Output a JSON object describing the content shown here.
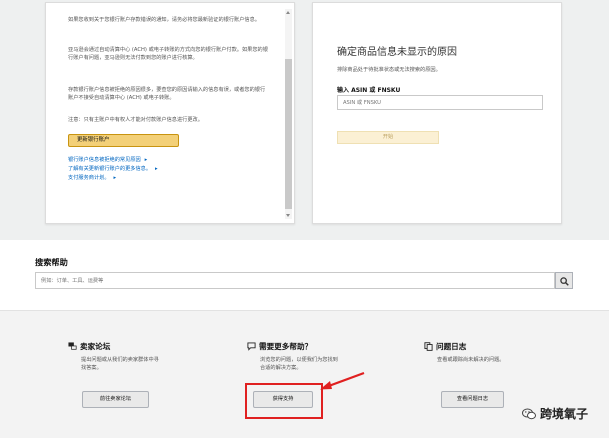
{
  "account_panel": {
    "para1": "如果您收到关于您银行账户存款错误的通知，请务必将您最新验证的银行账户信息。",
    "para2": "亚马逊会通过自动清算中心 (ACH) 或电子转账的方式向您的银行账户付款。如果您的银行账户有问题，亚马逊则无法付款到您的账户进行核算。",
    "para3": "存款银行账户信息被拒绝的原因很多，要查您的原因请输入的信息有误，或者您的银行账户不接受自动清算中心 (ACH) 或电子转账。",
    "para4": "注意：只有主账户中有权人才能对付款账户信息进行更改。",
    "update_button": "更新银行账户",
    "links": [
      "银行账户信息被拒绝的常见原因",
      "了解有关更新银行账户的更多信息。",
      "支付服务商计划。"
    ]
  },
  "asin_panel": {
    "title": "确定商品信息未显示的原因",
    "description": "排除商品处于待批准状态或无法搜索的原因。",
    "input_label": "输入 ASIN 或 FNSKU",
    "input_placeholder": "ASIN 或 FNSKU",
    "submit_button": "开始"
  },
  "search": {
    "title": "搜索帮助",
    "placeholder": "例如：订单、工具、运费等"
  },
  "help_columns": [
    {
      "icon": "forum-icon",
      "title": "卖家论坛",
      "description": "提出问题或从我们的卖家群体中寻找答案。",
      "button": "前往卖家论坛"
    },
    {
      "icon": "chat-bubble-icon",
      "title": "需要更多帮助？",
      "description": "浏览您的问题，以便我们为您找到合适的解决方案。",
      "button": "获得支持"
    },
    {
      "icon": "copy-log-icon",
      "title": "问题日志",
      "description": "查看或跟踪尚未解决的问题。",
      "button": "查看问题日志"
    }
  ],
  "watermark": {
    "text": "跨境氧子"
  },
  "colors": {
    "accent_button": "#f3d078",
    "link": "#0066c0",
    "highlight": "#e02020"
  }
}
